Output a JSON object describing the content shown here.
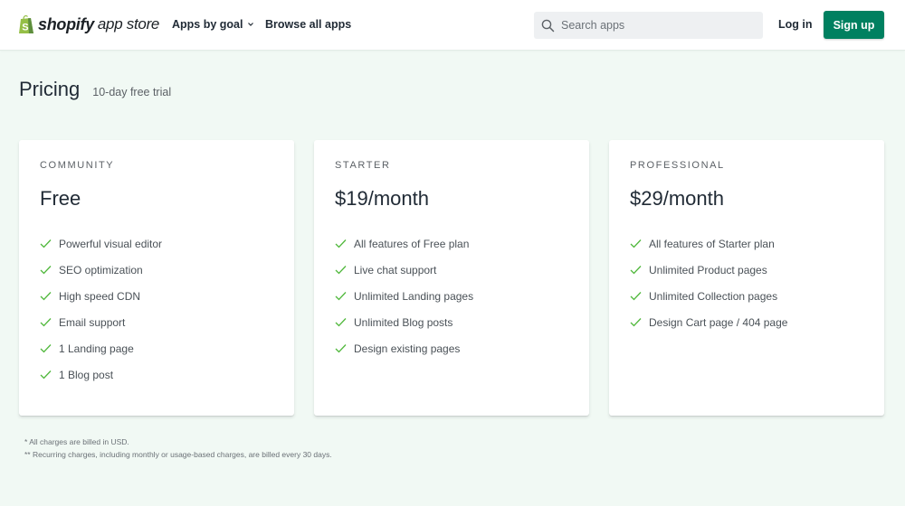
{
  "header": {
    "logo": {
      "brand": "shopify",
      "suffix": "app store",
      "icon": "shopify-bag-icon"
    },
    "nav": [
      {
        "label": "Apps by goal",
        "has_dropdown": true
      },
      {
        "label": "Browse all apps",
        "has_dropdown": false
      }
    ],
    "search": {
      "placeholder": "Search apps",
      "value": ""
    },
    "login_label": "Log in",
    "signup_label": "Sign up",
    "accent_color": "#008060"
  },
  "page": {
    "title": "Pricing",
    "subtitle": "10-day free trial",
    "background_color": "#f1f9f4"
  },
  "plans": [
    {
      "name": "COMMUNITY",
      "price": "Free",
      "features": [
        "Powerful visual editor",
        "SEO optimization",
        "High speed CDN",
        "Email support",
        "1 Landing page",
        "1 Blog post"
      ]
    },
    {
      "name": "STARTER",
      "price": "$19/month",
      "features": [
        "All features of Free plan",
        "Live chat support",
        "Unlimited Landing pages",
        "Unlimited Blog posts",
        "Design existing pages"
      ]
    },
    {
      "name": "PROFESSIONAL",
      "price": "$29/month",
      "features": [
        "All features of Starter plan",
        "Unlimited Product pages",
        "Unlimited Collection pages",
        "Design Cart page / 404 page"
      ]
    }
  ],
  "footnotes": [
    "* All charges are billed in USD.",
    "** Recurring charges, including monthly or usage-based charges, are billed every 30 days."
  ],
  "check_color": "#50b83c"
}
